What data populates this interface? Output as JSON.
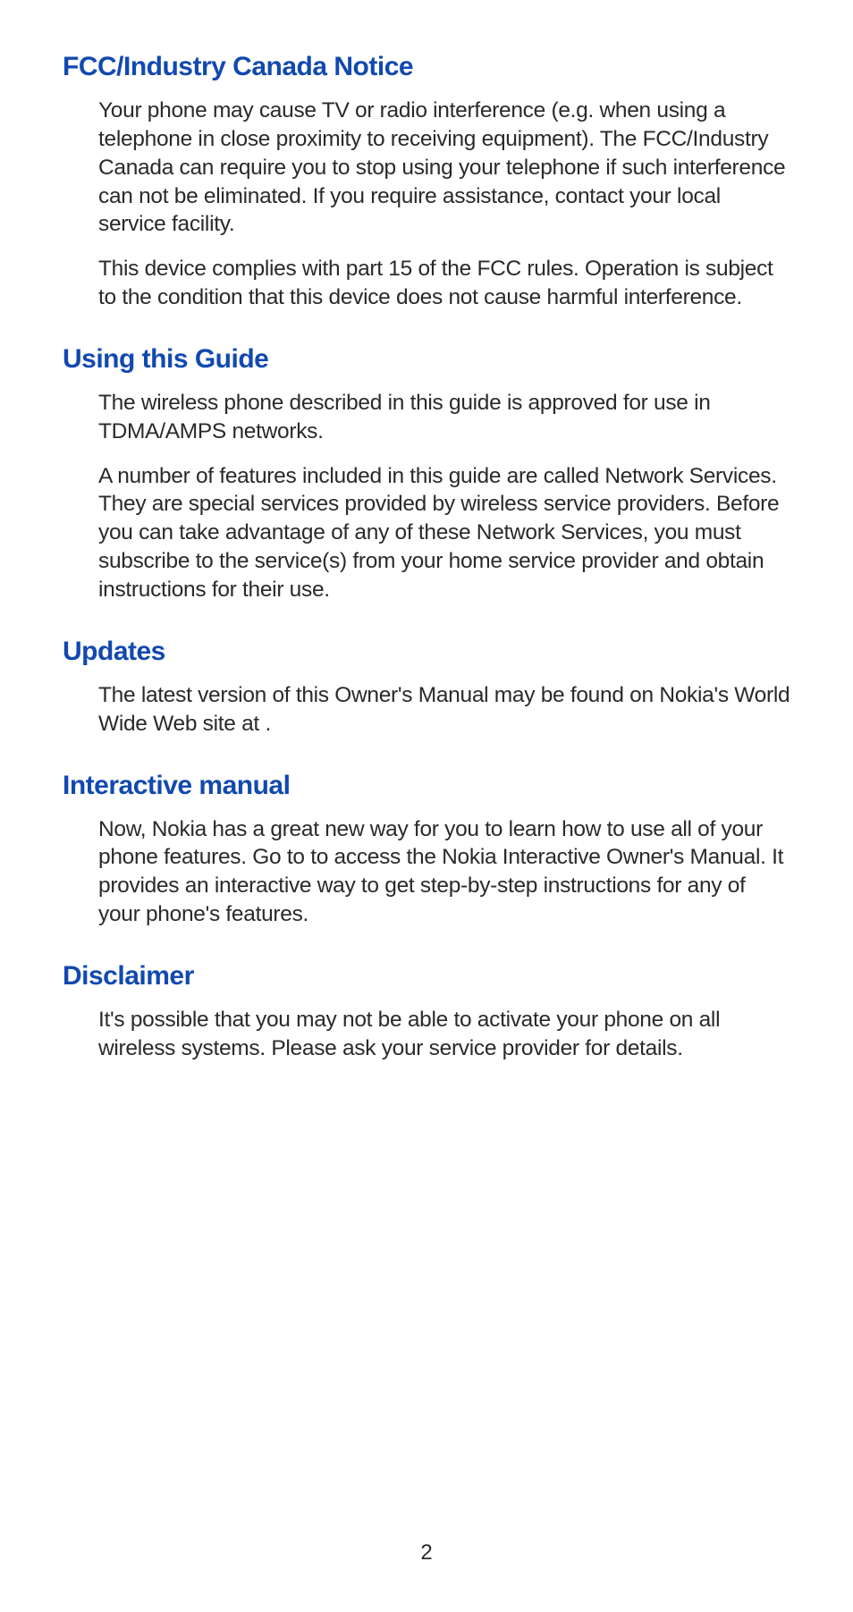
{
  "sections": [
    {
      "heading": "FCC/Industry Canada Notice",
      "paragraphs": [
        "Your phone may cause TV or radio interference (e.g. when using a telephone in close proximity to receiving equipment). The FCC/Industry Canada can require you to stop using your telephone if such interference can not be eliminated. If you require assistance, contact your local service facility.",
        "This device complies with part 15 of the FCC rules. Operation is subject to the condition that this device does not cause harmful interference."
      ]
    },
    {
      "heading": "Using this Guide",
      "paragraphs": [
        "The wireless phone described in this guide is approved for use in TDMA/AMPS networks.",
        "A number of features included in this guide are called Network Services. They are special services provided by wireless service providers. Before you can take advantage of any of these Network Services, you must subscribe to the service(s) from your home service provider and obtain instructions for their use."
      ]
    },
    {
      "heading": "Updates",
      "paragraphs": [
        "The latest version of this Owner's Manual may be found on Nokia's World Wide Web site at                                           ."
      ]
    },
    {
      "heading": "Interactive manual",
      "paragraphs": [
        "Now, Nokia has a great new way for you to learn how to use all of your phone features. Go to                                         to access the Nokia Interactive Owner's Manual. It provides an interactive way to get step-by-step instructions for any of your phone's features."
      ]
    },
    {
      "heading": "Disclaimer",
      "paragraphs": [
        "It's possible that you may not be able to activate your phone on all wireless systems. Please ask your service provider for details."
      ]
    }
  ],
  "pageNumber": "2"
}
